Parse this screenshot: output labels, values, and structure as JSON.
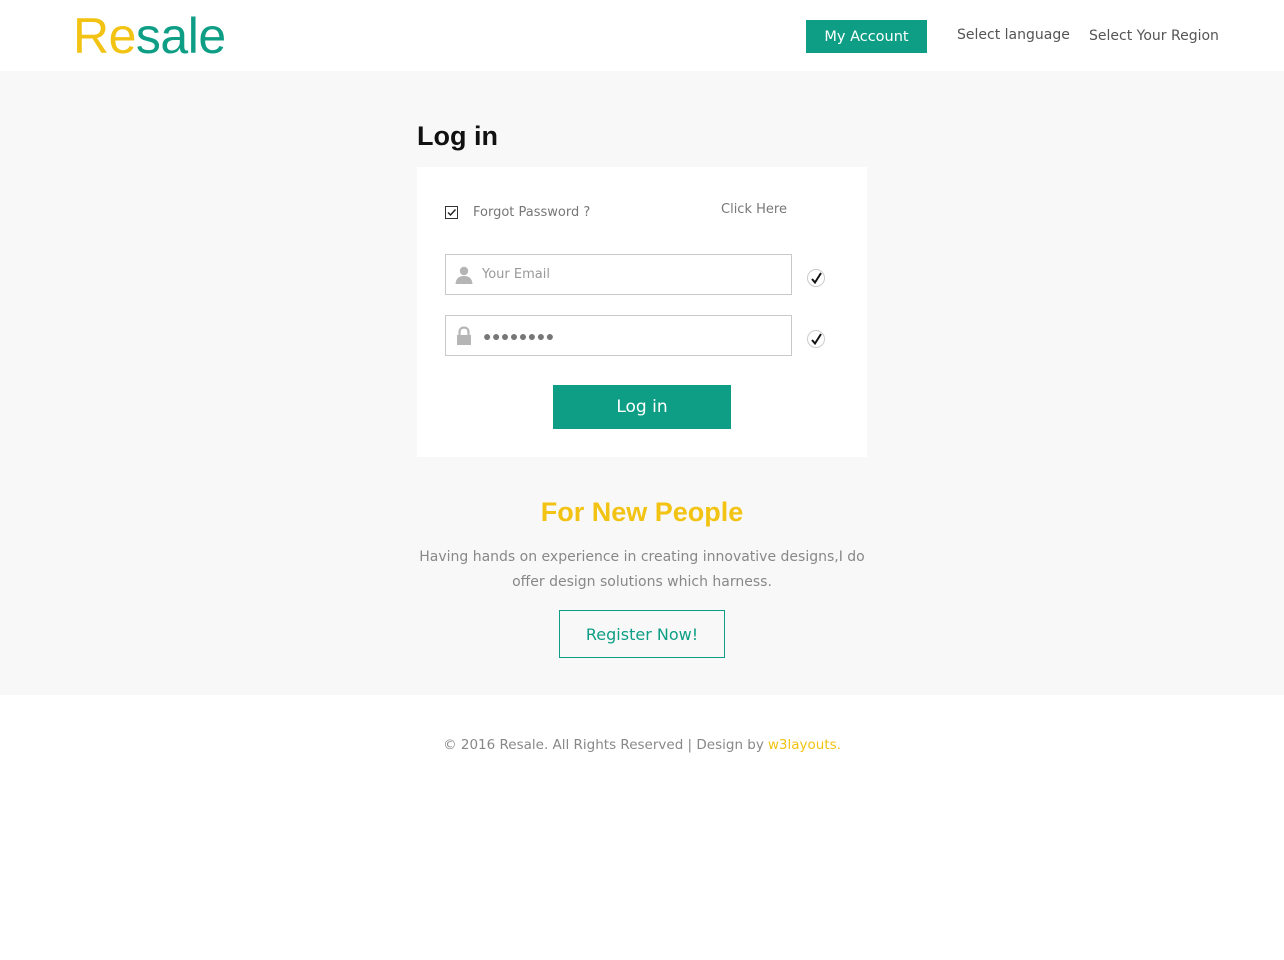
{
  "header": {
    "logo_re": "Re",
    "logo_sale": "sale",
    "account_label": "My Account",
    "language_label": "Select language",
    "region_label": "Select Your Region"
  },
  "login": {
    "title": "Log in",
    "forgot_label": "Forgot Password ?",
    "click_here": "Click Here",
    "email_placeholder": "Your Email",
    "password_value": "●●●●●●●●",
    "submit_label": "Log in"
  },
  "new_people": {
    "title": "For New People",
    "description": "Having hands on experience in creating innovative designs,I do offer design solutions which harness.",
    "register_label": "Register Now!"
  },
  "footer": {
    "copyright": "© 2016 Resale. All Rights Reserved | Design by",
    "designer": "w3layouts."
  },
  "colors": {
    "brand_green": "#0e9e85",
    "brand_yellow": "#f2c313"
  },
  "icons": {
    "email": "user-icon",
    "password": "lock-icon",
    "valid": "check-icon"
  }
}
